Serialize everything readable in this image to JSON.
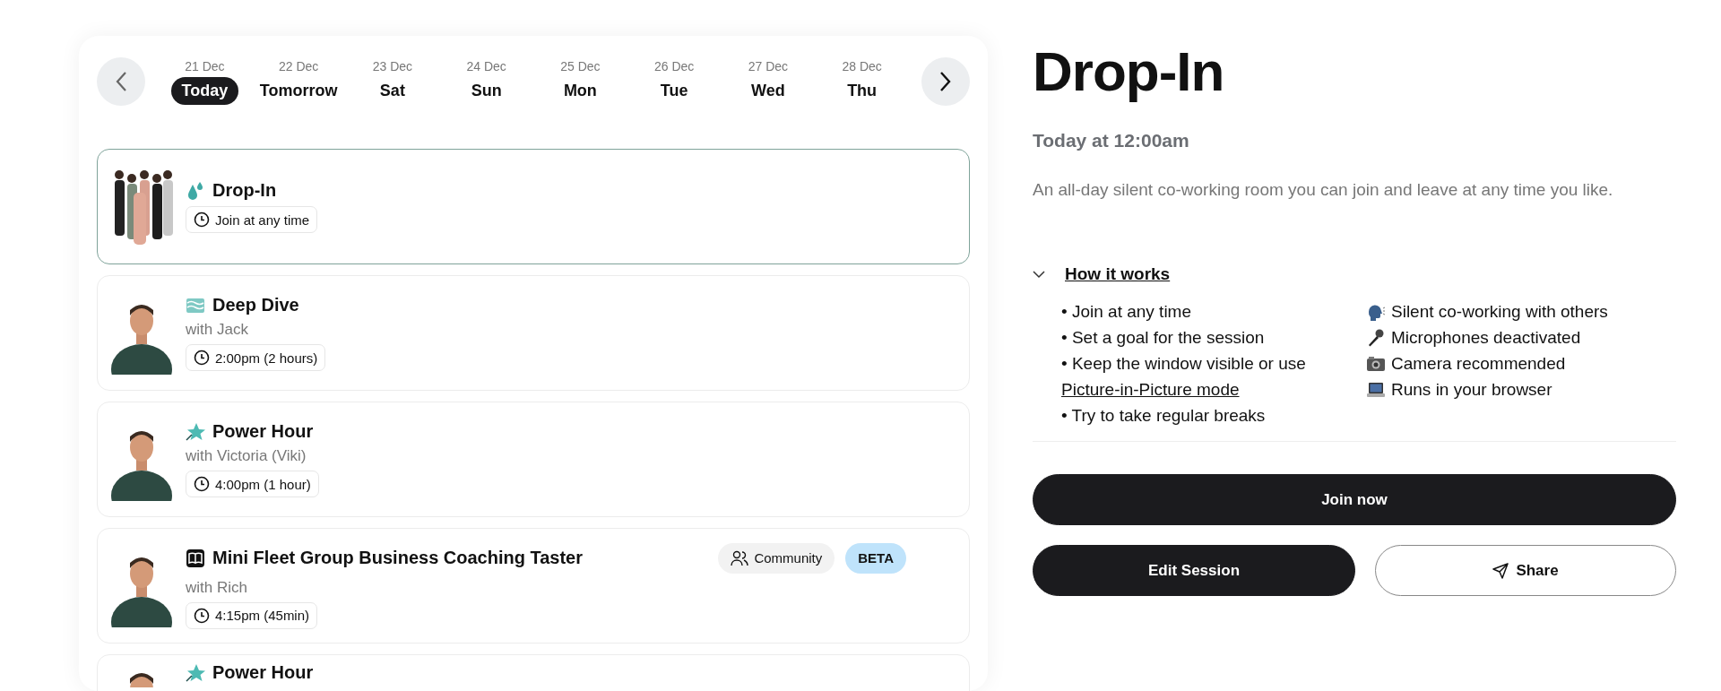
{
  "date_strip": {
    "days": [
      {
        "date": "21 Dec",
        "label": "Today",
        "selected": true
      },
      {
        "date": "22 Dec",
        "label": "Tomorrow",
        "selected": false
      },
      {
        "date": "23 Dec",
        "label": "Sat",
        "selected": false
      },
      {
        "date": "24 Dec",
        "label": "Sun",
        "selected": false
      },
      {
        "date": "25 Dec",
        "label": "Mon",
        "selected": false
      },
      {
        "date": "26 Dec",
        "label": "Tue",
        "selected": false
      },
      {
        "date": "27 Dec",
        "label": "Wed",
        "selected": false
      },
      {
        "date": "28 Dec",
        "label": "Thu",
        "selected": false
      }
    ]
  },
  "sessions": [
    {
      "kind": "drop",
      "title": "Drop-In",
      "time": "Join at any time",
      "selected": true
    },
    {
      "kind": "wave",
      "title": "Deep Dive",
      "host": "with Jack",
      "time": "2:00pm (2 hours)",
      "selected": false
    },
    {
      "kind": "star",
      "title": "Power Hour",
      "host": "with Victoria (Viki)",
      "time": "4:00pm (1 hour)",
      "selected": false
    },
    {
      "kind": "book",
      "title": "Mini Fleet Group Business Coaching Taster",
      "host": "with Rich",
      "time": "4:15pm (45min)",
      "selected": false,
      "tags": [
        {
          "kind": "community",
          "label": "Community"
        },
        {
          "kind": "beta",
          "label": "BETA"
        }
      ]
    },
    {
      "kind": "star",
      "title": "Power Hour",
      "selected": false
    }
  ],
  "detail": {
    "title": "Drop-In",
    "when": "Today at 12:00am",
    "description": "An all-day silent co-working room you can join and leave at any time you like.",
    "how_it_works": {
      "heading": "How it works",
      "expanded": true,
      "steps": [
        {
          "text": "• Join at any time"
        },
        {
          "text": "• Set a goal for the session"
        },
        {
          "text": "• Keep the window visible or use",
          "link": "Picture-in-Picture mode"
        },
        {
          "text": "• Try to take regular breaks"
        }
      ],
      "features": [
        {
          "kind": "speaking",
          "text": "Silent co-working with others"
        },
        {
          "kind": "microphone",
          "text": "Microphones deactivated"
        },
        {
          "kind": "camera",
          "text": "Camera recommended"
        },
        {
          "kind": "laptop",
          "text": "Runs in your browser"
        }
      ]
    },
    "buttons": {
      "join": "Join now",
      "edit": "Edit Session",
      "share": "Share"
    }
  }
}
